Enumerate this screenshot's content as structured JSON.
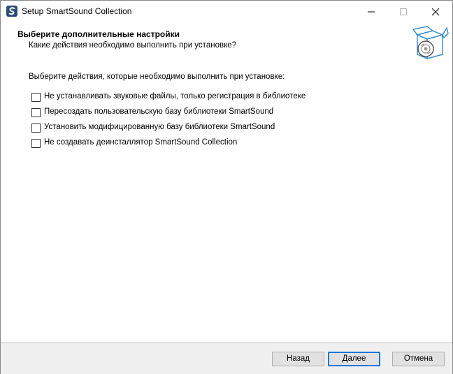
{
  "window": {
    "title": "Setup SmartSound Collection",
    "app_icon": "smartsound-s-icon",
    "controls": {
      "minimize_icon": "minimize-icon",
      "maximize_icon": "maximize-icon",
      "close_icon": "close-icon"
    }
  },
  "header": {
    "title": "Выберите дополнительные настройки",
    "subtitle": "Какие действия необходимо выполнить при установке?",
    "image": "setup-box-disc-icon"
  },
  "content": {
    "instruction": "Выберите действия, которые необходимо выполнить при установке:",
    "options": [
      {
        "label": "Не устанавливать звуковые файлы, только регистрация в библиотеке",
        "checked": false
      },
      {
        "label": "Пересоздать пользовательскую базу библиотеки SmartSound",
        "checked": false
      },
      {
        "label": "Установить модифицированную базу библиотеки SmartSound",
        "checked": false
      },
      {
        "label": "Не создавать деинсталлятор SmartSound Collection",
        "checked": false
      }
    ]
  },
  "footer": {
    "back_label": "Назад",
    "next_label": "Далее",
    "cancel_label": "Отмена"
  },
  "colors": {
    "default_button_border": "#0078d7",
    "button_face": "#e1e1e1",
    "footer_bg": "#f0f0f0",
    "logo_blue": "#2b4a78"
  }
}
